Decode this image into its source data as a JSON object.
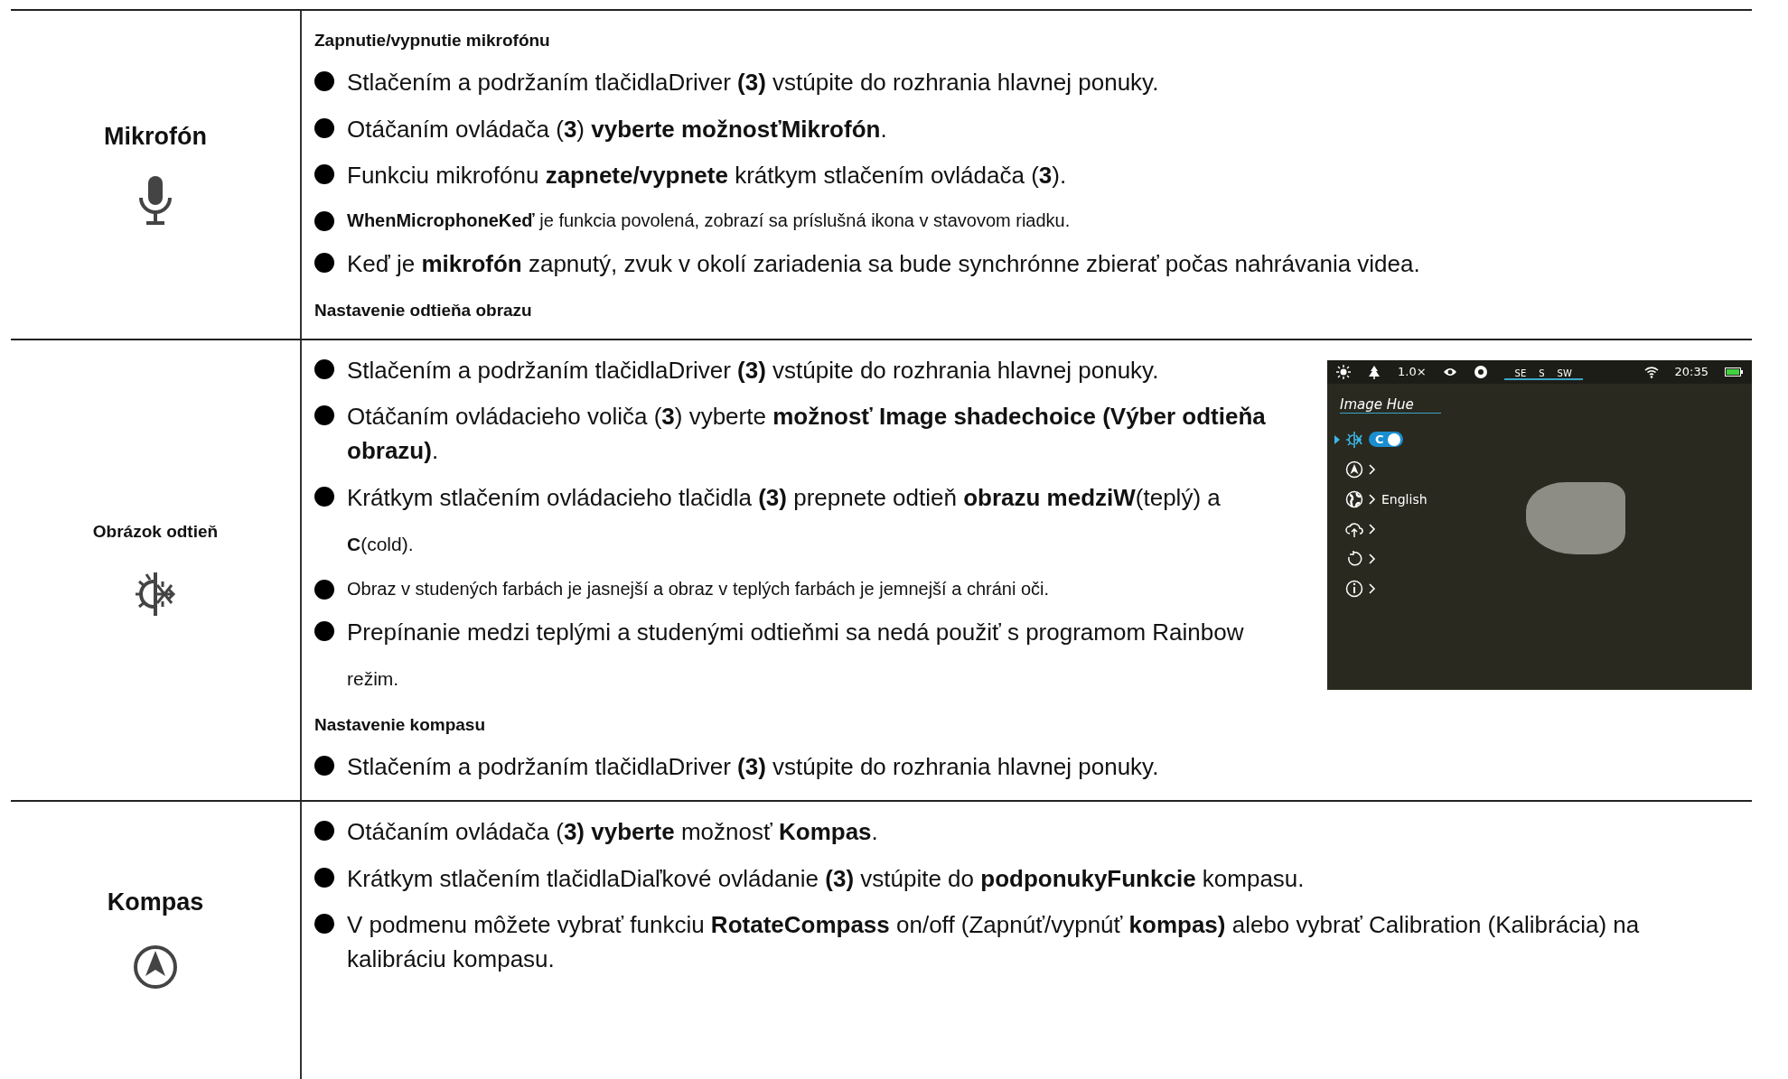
{
  "rows": [
    {
      "kind": "major",
      "label": "Mikrofón",
      "blocks": [
        {
          "kind": "heading",
          "text": "Zapnutie/vypnutie mikrofónu"
        },
        {
          "kind": "bullet",
          "text": "Stlačením a podržaním tlačidlaDriver **(3)** vstúpite do rozhrania hlavnej ponuky."
        },
        {
          "kind": "bullet",
          "text": "Otáčaním ovládača (**3**) **vyberte možnosťMikrofón**."
        },
        {
          "kind": "bullet",
          "text": "Funkciu mikrofónu **zapnete/vypnete** krátkym stlačením ovládača (**3**)."
        },
        {
          "kind": "note",
          "text": "**WhenMicrophoneKeď** je funkcia povolená, zobrazí sa príslušná ikona v stavovom riadku."
        },
        {
          "kind": "bullet",
          "text": "Keď je **mikrofón** zapnutý, zvuk v okolí zariadenia sa bude synchrónne zbierať počas nahrávania videa."
        },
        {
          "kind": "heading",
          "text": "Nastavenie odtieňa obrazu"
        }
      ]
    },
    {
      "kind": "minor",
      "label": "Obrázok odtieň",
      "blocks": [
        {
          "kind": "bullet",
          "text": "Stlačením a podržaním tlačidlaDriver **(3)** vstúpite do rozhrania hlavnej ponuky."
        },
        {
          "kind": "bullet",
          "text": "Otáčaním ovládacieho voliča (**3**) vyberte **možnosť Image shadechoice (Výber odtieňa obrazu)**."
        },
        {
          "kind": "bullet",
          "text": "Krátkym stlačením ovládacieho tlačidla **(3)** prepnete odtieň **obrazu medziW**(teplý) a"
        },
        {
          "kind": "line",
          "text": "**C**(cold)."
        },
        {
          "kind": "note",
          "text": "Obraz v studených farbách je jasnejší a obraz v teplých farbách je jemnejší a chráni oči."
        },
        {
          "kind": "bullet",
          "text": "Prepínanie medzi teplými a studenými odtieňmi sa nedá použiť s programom Rainbow"
        },
        {
          "kind": "line",
          "text": "režim."
        },
        {
          "kind": "heading",
          "text": "Nastavenie kompasu"
        },
        {
          "kind": "bullet",
          "text": "Stlačením a podržaním tlačidlaDriver **(3)** vstúpite do rozhrania hlavnej ponuky."
        }
      ],
      "device_screen": {
        "zoom": "1.0×",
        "compass": [
          "SE",
          "S",
          "SW"
        ],
        "time": "20:35",
        "menu_title": "Image Hue",
        "menu": [
          {
            "kind": "toggle",
            "selected": true,
            "toggle_label": "C",
            "on": true
          },
          {
            "kind": "submenu",
            "selected": false
          },
          {
            "kind": "submenu",
            "selected": false,
            "value": "English"
          },
          {
            "kind": "submenu",
            "selected": false
          },
          {
            "kind": "submenu",
            "selected": false
          },
          {
            "kind": "submenu",
            "selected": false
          }
        ]
      }
    },
    {
      "kind": "major",
      "label": "Kompas",
      "blocks": [
        {
          "kind": "bullet",
          "text": "Otáčaním ovládača (**3) vyberte** možnosť **Kompas**."
        },
        {
          "kind": "bullet",
          "text": "Krátkym stlačením tlačidlaDiaľkové ovládanie **(3)** vstúpite do **podponukyFunkcie** kompasu."
        },
        {
          "kind": "bullet",
          "text": "V podmenu môžete vybrať funkciu **RotateCompass** on/off (Zapnúť/vypnúť **kompas)** alebo vybrať Calibration (Kalibrácia) na kalibráciu kompasu."
        }
      ]
    }
  ]
}
